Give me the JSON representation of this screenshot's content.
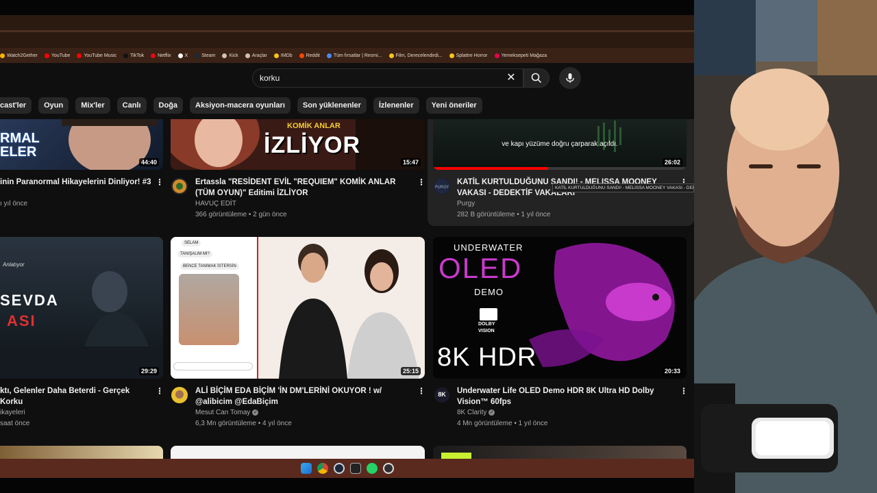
{
  "browser": {
    "bookmarks": [
      {
        "label": "Watch2Gether",
        "color": "#ffb300"
      },
      {
        "label": "YouTube",
        "color": "#ff0000"
      },
      {
        "label": "YouTube Music",
        "color": "#ff0000"
      },
      {
        "label": "TikTok",
        "color": "#111111"
      },
      {
        "label": "Netflix",
        "color": "#e50914"
      },
      {
        "label": "X",
        "color": "#ffffff"
      },
      {
        "label": "Steam",
        "color": "#1b2838"
      },
      {
        "label": "Kick",
        "color": "#cfc2b6"
      },
      {
        "label": "Araçlar",
        "color": "#cfc2b6"
      },
      {
        "label": "IMDb",
        "color": "#f5c518"
      },
      {
        "label": "Reddit",
        "color": "#ff4500"
      },
      {
        "label": "Tüm fırsatlar | Resmi...",
        "color": "#4a8af4"
      },
      {
        "label": "Film, Derecelendirdi...",
        "color": "#f5c518"
      },
      {
        "label": "Splattre Horror",
        "color": "#f5c518"
      },
      {
        "label": "Yemeksepeti Mağaza",
        "color": "#ea004b"
      }
    ]
  },
  "search": {
    "query": "korku"
  },
  "chips": [
    "cast'ler",
    "Oyun",
    "Mix'ler",
    "Canlı",
    "Doğa",
    "Aksiyon-macera oyunları",
    "Son yüklenenler",
    "İzlenenler",
    "Yeni öneriler"
  ],
  "videos": [
    {
      "thumb_text": "RMAL ELER",
      "duration": "44:40",
      "title": "inin Paranormal Hikayelerini Dinliyor! #3",
      "channel": "",
      "meta": "ı yıl önce"
    },
    {
      "thumb_text": "İZLİYOR",
      "thumb_sub": "KOMİK ANLAR",
      "duration": "15:47",
      "title": "Ertassla \"RESİDENT EVİL \"REQUIEM\" KOMİK ANLAR (TÜM OYUN)\" Editimi İZLİYOR",
      "channel": "HAVUÇ EDİT",
      "meta": "366 görüntüleme • 2 gün önce"
    },
    {
      "thumb_text": "ve kapı yüzüme doğru çarparak açıldı.",
      "duration": "26:02",
      "title": "KATİL KURTULDUĞUNU SANDI! - MELISSA MOONEY VAKASI - DEDEKTİF VAKALARI",
      "channel": "Purgy",
      "meta": "282 B görüntüleme • 1 yıl önce"
    },
    {
      "thumb_text": "SEVDA",
      "thumb_sub": "ASI",
      "thumb_tag": "Anlatıyor",
      "duration": "29:29",
      "title": "ktı, Gelenler Daha Beterdi -   Gerçek Korku",
      "channel": "ikayeleri",
      "meta": "saat önce"
    },
    {
      "thumb_chat": [
        "SELAM",
        "TANIŞALIM MI?",
        "BENCE TANIMAK İSTERSİN"
      ],
      "duration": "25:15",
      "title": "ALİ BİÇİM EDA BİÇİM 'İN DM'LERİNİ OKUYOR ! w/ @alibicim @EdaBiçim",
      "channel": "Mesut Can Tomay",
      "meta": "6,3 Mn görüntüleme • 4 yıl önce"
    },
    {
      "thumb_lines": [
        "UNDERWATER",
        "OLED",
        "DEMO",
        "DOLBY",
        "VISION",
        "8K HDR"
      ],
      "duration": "20:33",
      "title": "Underwater Life OLED Demo HDR 8K Ultra HD Dolby Vision™ 60fps",
      "channel": "8K Clarity",
      "meta": "4 Mn görüntüleme • 1 yıl önce",
      "avatar_text": "8K"
    }
  ],
  "tooltip": "KATİL KURTULDUĞUNU SANDI! - MELISSA MOONEY VAKASI - DEDEKTİF VAKALARI"
}
